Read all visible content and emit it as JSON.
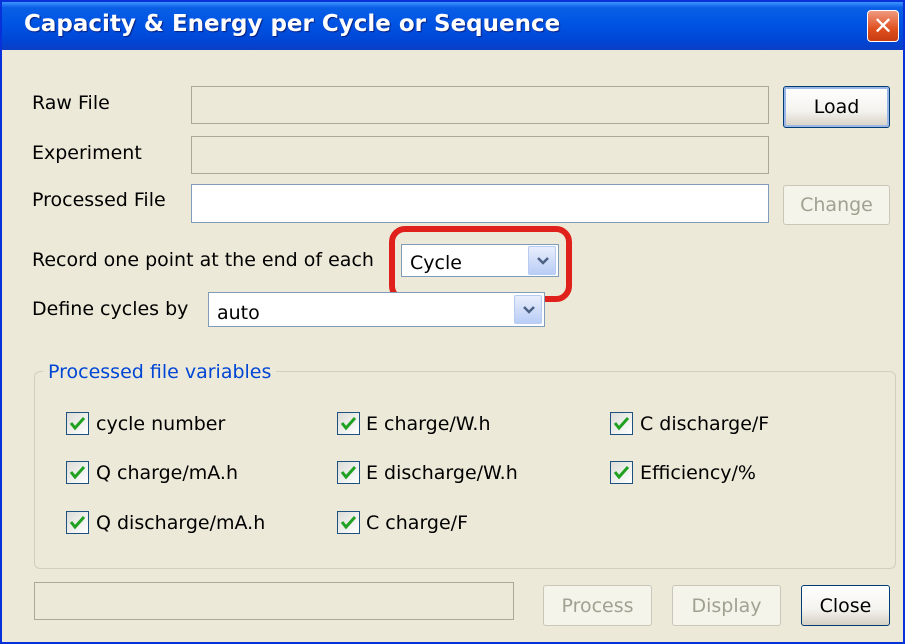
{
  "window": {
    "title": "Capacity & Energy per Cycle or Sequence",
    "close_glyph": "✕"
  },
  "form": {
    "raw_file_label": "Raw File",
    "raw_file_value": "",
    "experiment_label": "Experiment",
    "experiment_value": "",
    "processed_file_label": "Processed File",
    "processed_file_value": "",
    "record_label": "Record one point at the end of each",
    "record_value": "Cycle",
    "define_label": "Define cycles by",
    "define_value": "auto"
  },
  "buttons": {
    "load": "Load",
    "change": "Change",
    "process": "Process",
    "display": "Display",
    "close": "Close"
  },
  "variables": {
    "title": "Processed file variables",
    "items": [
      {
        "label": "cycle number",
        "checked": true
      },
      {
        "label": "Q charge/mA.h",
        "checked": true
      },
      {
        "label": "Q discharge/mA.h",
        "checked": true
      },
      {
        "label": "E charge/W.h",
        "checked": true
      },
      {
        "label": "E discharge/W.h",
        "checked": true
      },
      {
        "label": "C charge/F",
        "checked": true
      },
      {
        "label": "C discharge/F",
        "checked": true
      },
      {
        "label": "Efficiency/%",
        "checked": true
      }
    ]
  },
  "colors": {
    "highlight": "#e0201b",
    "titlebar": "#0054e3",
    "group_title": "#0046d5"
  },
  "icons": {
    "close": "close-icon",
    "dropdown": "chevron-down-icon",
    "checkbox": "checkmark-icon"
  }
}
